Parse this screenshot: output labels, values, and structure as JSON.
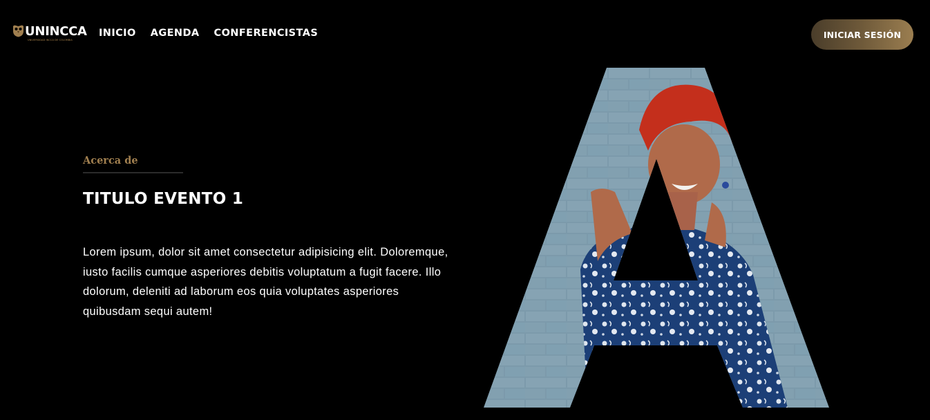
{
  "brand": {
    "name": "UNINCCA",
    "tagline": "UNIVERSIDAD INCCA DE COLOMBIA",
    "colors": {
      "gold": "#a07f4f",
      "button_from": "#4a3d2a",
      "button_to": "#9b7e50"
    }
  },
  "nav": {
    "links": [
      {
        "label": "INICIO"
      },
      {
        "label": "AGENDA"
      },
      {
        "label": "CONFERENCISTAS"
      }
    ],
    "login_label": "INICIAR SESIÓN"
  },
  "about": {
    "eyebrow": "Acerca de",
    "title": "TITULO EVENTO 1",
    "body": "Lorem ipsum, dolor sit amet consectetur adipisicing elit. Doloremque, iusto facilis cumque asperiores debitis voluptatum a fugit facere. Illo dolorum, deleniti ad laborum eos quia voluptates asperiores quibusdam sequi autem!"
  },
  "hero": {
    "icon": "letter-a-photo-mask",
    "colors": {
      "wall": "#7a98a8",
      "hair": "#c42f1c",
      "skin": "#b06a4a",
      "dress": "#1b3f78"
    }
  }
}
